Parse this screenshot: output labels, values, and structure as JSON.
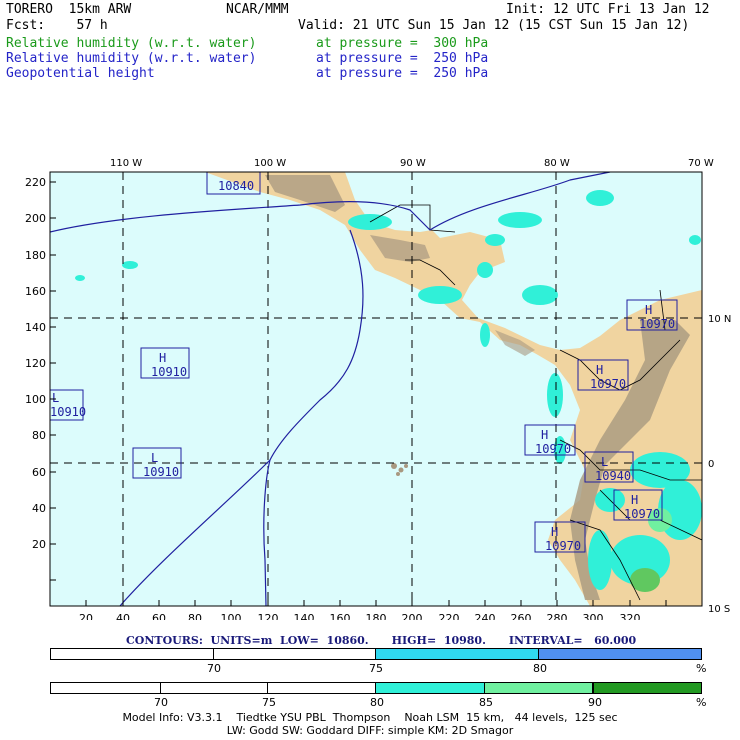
{
  "header": {
    "model": "TORERO  15km ARW",
    "org": "NCAR/MMM",
    "init": "Init: 12 UTC Fri 13 Jan 12",
    "fcst": "Fcst:    57 h",
    "valid": "Valid: 21 UTC Sun 15 Jan 12 (15 CST Sun 15 Jan 12)",
    "fields": [
      {
        "name": "Relative humidity (w.r.t. water)",
        "level": "at pressure =  300 hPa",
        "color": "#1a9a1a"
      },
      {
        "name": "Relative humidity (w.r.t. water)",
        "level": "at pressure =  250 hPa",
        "color": "#2424c8"
      },
      {
        "name": "Geopotential height",
        "level": "at pressure =  250 hPa",
        "color": "#2424c8"
      }
    ]
  },
  "map": {
    "lon_labels": [
      "110 W",
      "100 W",
      "90 W",
      "80 W",
      "70 W"
    ],
    "lat_labels": [
      "10 N",
      "0",
      "10 S"
    ],
    "x_ticks": [
      "20",
      "40",
      "60",
      "80",
      "100",
      "120",
      "140",
      "160",
      "180",
      "200",
      "220",
      "240",
      "260",
      "280",
      "300",
      "320"
    ],
    "y_ticks": [
      "220",
      "200",
      "180",
      "160",
      "140",
      "120",
      "100",
      "80",
      "60",
      "40",
      "20"
    ],
    "highs_lows": [
      {
        "type": "H",
        "value": "10910"
      },
      {
        "type": "L",
        "value": "10910"
      },
      {
        "type": "L",
        "value": "10910"
      },
      {
        "type": "H",
        "value": "10970"
      },
      {
        "type": "H",
        "value": "10970"
      },
      {
        "type": "H",
        "value": "10970"
      },
      {
        "type": "L",
        "value": "10940"
      },
      {
        "type": "H",
        "value": "10970"
      },
      {
        "type": "H",
        "value": "10970"
      },
      {
        "type": "",
        "value": "10840"
      }
    ],
    "colors": {
      "ocean": "#dcfcfc",
      "land": "#f0d4a0",
      "terrain": "#a89880",
      "grid": "#000000"
    }
  },
  "contours": "CONTOURS:  UNITS=m  LOW=  10860.      HIGH=  10980.      INTERVAL=   60.000",
  "legend_250": {
    "labels": [
      "70",
      "75",
      "80",
      "%"
    ],
    "colors": [
      "#ffffff",
      "#ffffff",
      "#30d8f0",
      "#5090f0"
    ]
  },
  "legend_300": {
    "labels": [
      "70",
      "75",
      "80",
      "85",
      "90",
      "%"
    ],
    "colors": [
      "#ffffff",
      "#ffffff",
      "#ffffff",
      "#30f0d8",
      "#70f0a0",
      "#60c860",
      "#229922"
    ]
  },
  "footer": {
    "line1": "Model Info: V3.3.1    Tiedtke YSU PBL  Thompson    Noah LSM  15 km,   44 levels,  125 sec",
    "line2": "LW: Godd SW: Goddard DIFF: simple KM: 2D Smagor"
  }
}
